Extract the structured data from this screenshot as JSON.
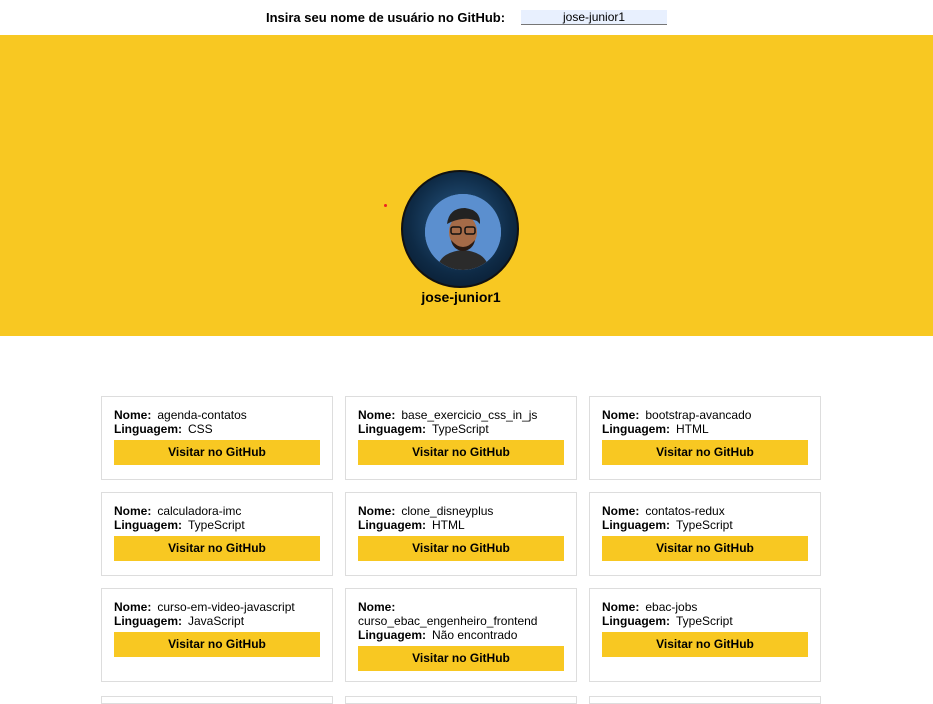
{
  "search": {
    "label": "Insira seu nome de usuário no GitHub:",
    "value": "jose-junior1"
  },
  "profile": {
    "username": "jose-junior1"
  },
  "labels": {
    "name": "Nome:",
    "language": "Linguagem:",
    "visit": "Visitar no GitHub"
  },
  "repos": [
    {
      "name": "agenda-contatos",
      "language": "CSS"
    },
    {
      "name": "base_exercicio_css_in_js",
      "language": "TypeScript"
    },
    {
      "name": "bootstrap-avancado",
      "language": "HTML"
    },
    {
      "name": "calculadora-imc",
      "language": "TypeScript"
    },
    {
      "name": "clone_disneyplus",
      "language": "HTML"
    },
    {
      "name": "contatos-redux",
      "language": "TypeScript"
    },
    {
      "name": "curso-em-video-javascript",
      "language": "JavaScript"
    },
    {
      "name": "curso_ebac_engenheiro_frontend",
      "language": "Não encontrado"
    },
    {
      "name": "ebac-jobs",
      "language": "TypeScript"
    }
  ],
  "colors": {
    "accent": "#f8c822"
  }
}
